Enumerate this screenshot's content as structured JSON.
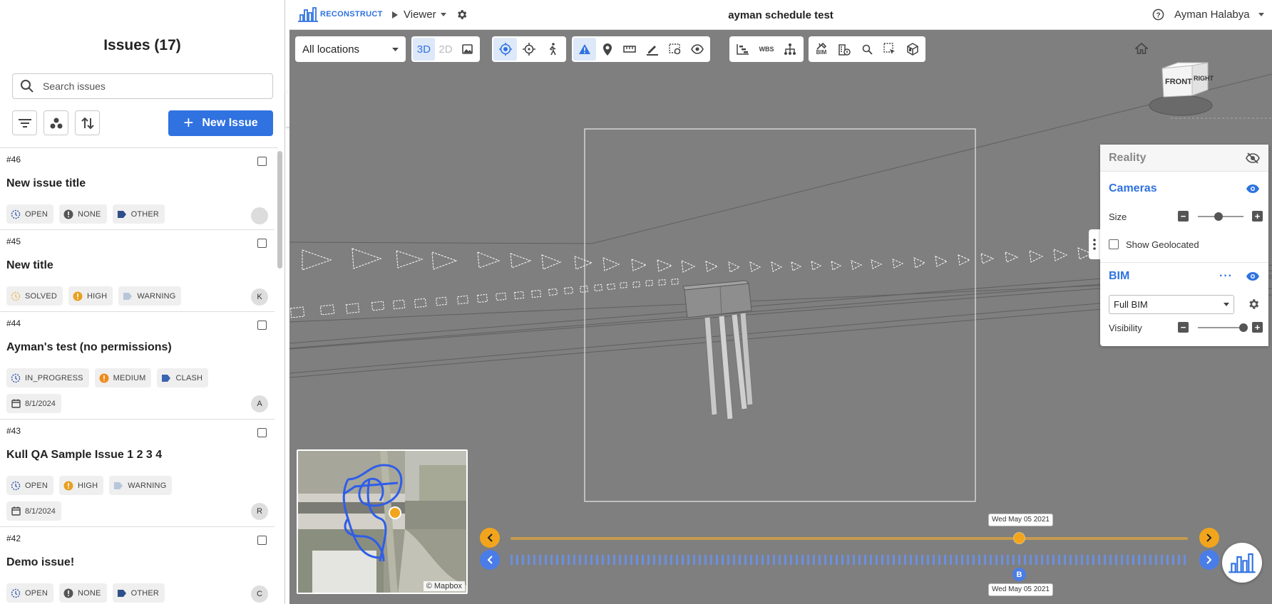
{
  "issues_panel": {
    "title": "Issues (17)",
    "search_placeholder": "Search issues",
    "new_issue_label": "New Issue",
    "issues": [
      {
        "number": "#46",
        "title": "New issue title",
        "status": "OPEN",
        "priority": "NONE",
        "type": "OTHER",
        "date": "",
        "avatar": ""
      },
      {
        "number": "#45",
        "title": "New title",
        "status": "SOLVED",
        "priority": "HIGH",
        "type": "WARNING",
        "date": "",
        "avatar": "K"
      },
      {
        "number": "#44",
        "title": "Ayman's test (no permissions)",
        "status": "IN_PROGRESS",
        "priority": "MEDIUM",
        "type": "CLASH",
        "date": "8/1/2024",
        "avatar": "A"
      },
      {
        "number": "#43",
        "title": "Kull QA Sample Issue 1 2 3 4",
        "status": "OPEN",
        "priority": "HIGH",
        "type": "WARNING",
        "date": "8/1/2024",
        "avatar": "R"
      },
      {
        "number": "#42",
        "title": "Demo issue!",
        "status": "OPEN",
        "priority": "NONE",
        "type": "OTHER",
        "date": "",
        "avatar": "C"
      }
    ]
  },
  "top_bar": {
    "logo_text": "RECONSTRUCT",
    "viewer_label": "Viewer",
    "project_title": "ayman schedule test",
    "user_name": "Ayman Halabya"
  },
  "toolbar": {
    "location_value": "All locations",
    "btn_3d": "3D",
    "btn_2d": "2D",
    "wbs_label": "WBS",
    "bim_label": "BIM"
  },
  "reality_panel": {
    "reality_label": "Reality",
    "cameras_label": "Cameras",
    "size_label": "Size",
    "show_geolocated_label": "Show Geolocated",
    "bim_label": "BIM",
    "bim_select_value": "Full BIM",
    "visibility_label": "Visibility",
    "camera_size": 0.45,
    "bim_visibility": 1.0
  },
  "navcube": {
    "front": "FRONT",
    "right": "RIGHT"
  },
  "minimap": {
    "credit": "© Mapbox"
  },
  "timeline": {
    "top_date": "Wed May 05 2021",
    "bottom_date": "Wed May 05 2021",
    "marker_label": "B",
    "colors": {
      "top": "#e8a020",
      "bottom": "#4a7de8"
    }
  },
  "colors": {
    "accent": "#2f72e0",
    "viewport_bg": "#7f7f7f",
    "status_orange": "#e8a020"
  }
}
